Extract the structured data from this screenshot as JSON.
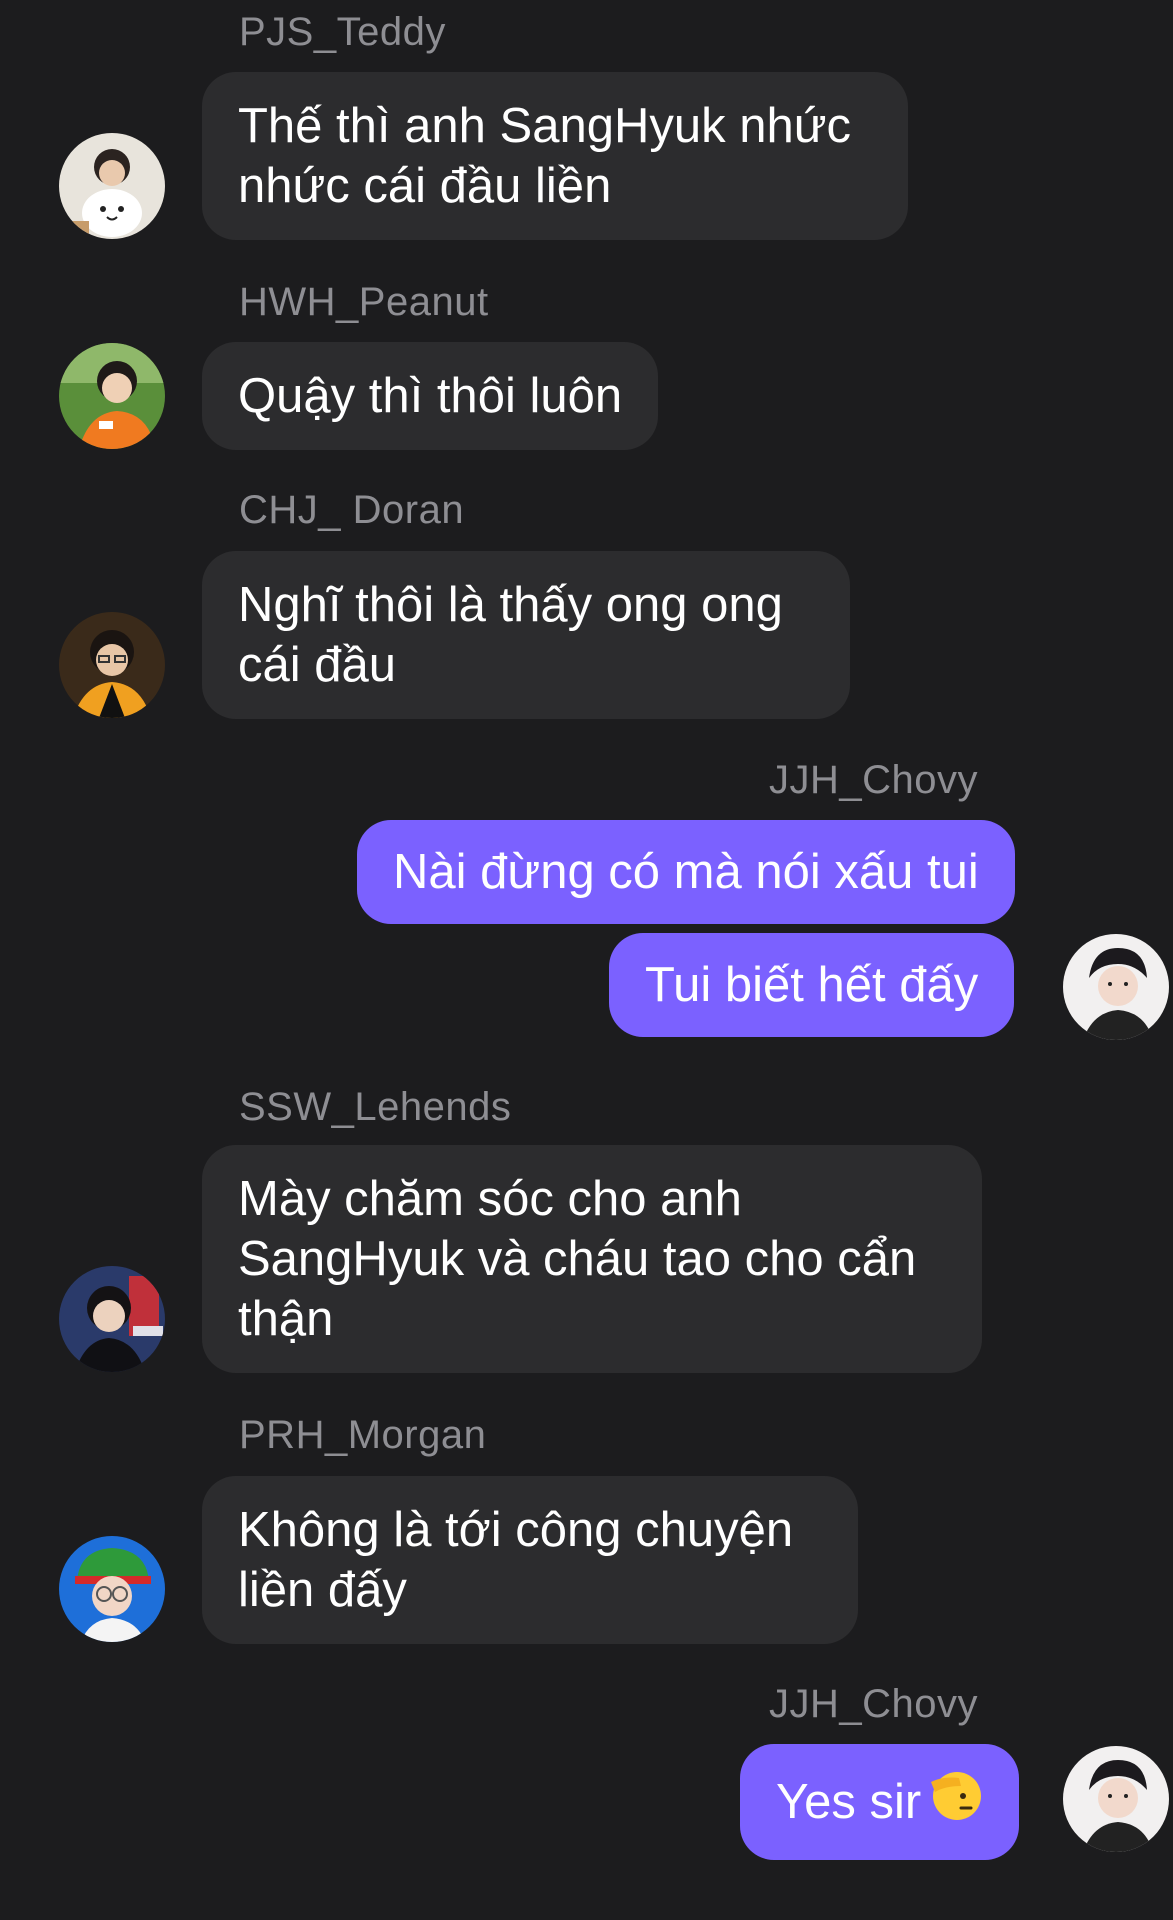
{
  "messages": [
    {
      "sender": "PJS_Teddy",
      "lines": [
        "Thế thì anh SangHyuk nhức",
        "nhức cái đầu liền"
      ],
      "avatar_icon": "avatar-teddy-icon",
      "avatar_color": "#e8e4dc"
    },
    {
      "sender": "HWH_Peanut",
      "lines": [
        "Quậy thì thôi luôn"
      ],
      "avatar_icon": "avatar-peanut-icon",
      "avatar_color": "#5a8f3a"
    },
    {
      "sender": "CHJ_ Doran",
      "lines": [
        "Nghĩ thôi là thấy ong ong",
        "cái đầu"
      ],
      "avatar_icon": "avatar-doran-icon",
      "avatar_color": "#3a2a1a"
    },
    {
      "sender": "JJH_Chovy",
      "lines": [
        "Nài đừng có mà nói xấu tui"
      ],
      "avatar_icon": "",
      "avatar_color": ""
    },
    {
      "sender": "",
      "lines": [
        "Tui biết hết đấy"
      ],
      "avatar_icon": "avatar-chovy-icon",
      "avatar_color": "#f2f0f0"
    },
    {
      "sender": "SSW_Lehends",
      "lines": [
        "Mày chăm sóc cho anh",
        "SangHyuk và cháu tao cho cẩn",
        "thận"
      ],
      "avatar_icon": "avatar-lehends-icon",
      "avatar_color": "#2a3a6a"
    },
    {
      "sender": "PRH_Morgan",
      "lines": [
        "Không là tới công chuyện",
        "liền đấy"
      ],
      "avatar_icon": "avatar-morgan-icon",
      "avatar_color": "#1e6fd9"
    },
    {
      "sender": "JJH_Chovy",
      "lines": [
        "Yes sir"
      ],
      "avatar_icon": "avatar-chovy-icon",
      "avatar_color": "#f2f0f0"
    }
  ],
  "colors": {
    "background": "#1c1c1e",
    "incoming_bubble": "#2c2c2e",
    "outgoing_bubble": "#7b61ff",
    "name_text": "#8e8e93"
  },
  "emoji_icon": "saluting-face-icon"
}
